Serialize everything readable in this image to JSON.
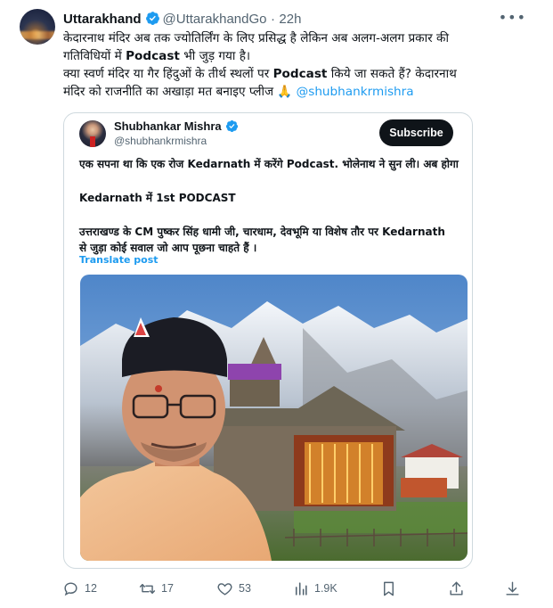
{
  "author": {
    "name": "Uttarakhand",
    "handle": "@UttarakhandGo",
    "separator": "·",
    "time": "22h"
  },
  "tweet": {
    "line1": "केदारनाथ मंदिर अब तक ज्योतिर्लिंग के लिए प्रसिद्ध है लेकिन अब अलग-अलग प्रकार की",
    "line2_pre": "गतिविधियों में ",
    "line2_bold": "Podcast",
    "line2_post": " भी जुड़ गया है।",
    "line3_pre": "क्या स्वर्ण मंदिर या गैर हिंदुओं के तीर्थ स्थलों पर ",
    "line3_bold": "Podcast",
    "line3_post": " किये जा सकते हैं? केदारनाथ",
    "line4_pre": "मंदिर को राजनीति का अखाड़ा मत बनाइए प्लीज 🙏 ",
    "mention": "@shubhankrmishra"
  },
  "quote": {
    "name": "Shubhankar Mishra",
    "handle": "@shubhankrmishra",
    "subscribe_label": "Subscribe",
    "para1": "एक सपना था कि एक रोज Kedarnath में करेंगे Podcast. भोलेनाथ ने सुन ली। अब होगा",
    "para2": "Kedarnath में 1st PODCAST",
    "para3a": "उत्तराखण्ड के CM पुष्कर सिंह धामी जी, चारधाम, देवभूमि या विशेष तौर पर Kedarnath",
    "para3b": "से जुड़ा कोई सवाल जो आप पूछना चाहते हैं ।",
    "translate_label": "Translate post"
  },
  "actions": {
    "replies": "12",
    "reposts": "17",
    "likes": "53",
    "views": "1.9K"
  },
  "colors": {
    "accent": "#1d9bf0",
    "muted": "#536471",
    "border": "#cfd9de"
  }
}
